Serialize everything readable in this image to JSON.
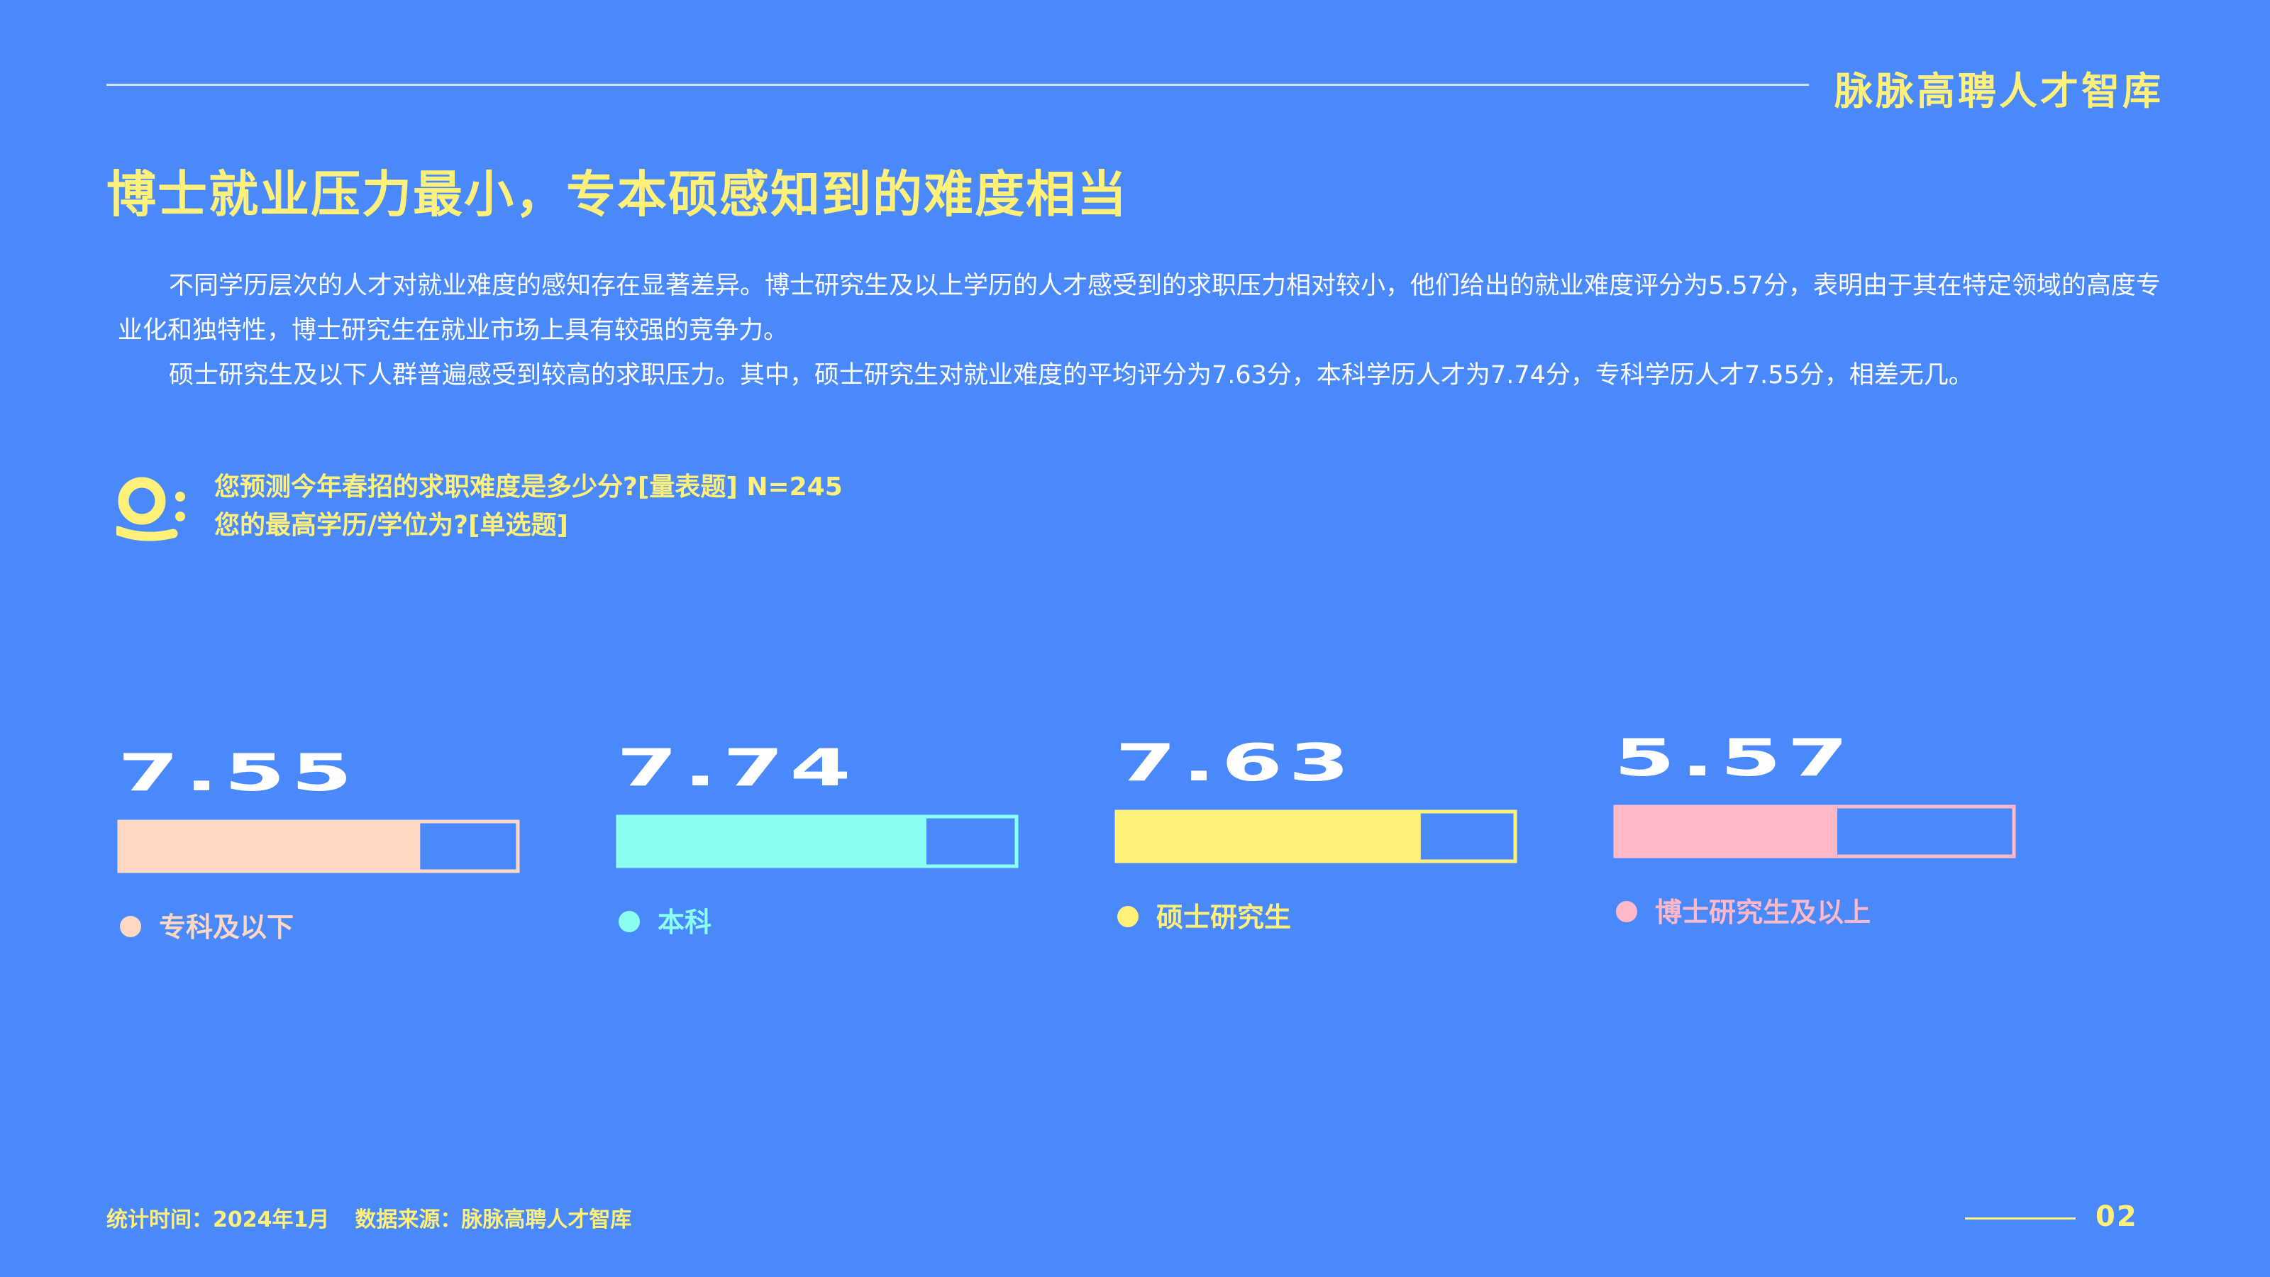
{
  "header": {
    "brand": "脉脉高聘人才智库"
  },
  "title": "博士就业压力最小，专本硕感知到的难度相当",
  "paragraphs": [
    "不同学历层次的人才对就业难度的感知存在显著差异。博士研究生及以上学历的人才感受到的求职压力相对较小，他们给出的就业难度评分为5.57分，表明由于其在特定领域的高度专业化和独特性，博士研究生在就业市场上具有较强的竞争力。",
    "硕士研究生及以下人群普遍感受到较高的求职压力。其中，硕士研究生对就业难度的平均评分为7.63分，本科学历人才为7.74分，专科学历人才7.55分，相差无几。"
  ],
  "questions": [
    "您预测今年春招的求职难度是多少分?[量表题] N=245",
    "您的最高学历/学位为?[单选题]"
  ],
  "chart_data": {
    "type": "bar",
    "categories": [
      "专科及以下",
      "本科",
      "硕士研究生",
      "博士研究生及以上"
    ],
    "values": [
      7.55,
      7.74,
      7.63,
      5.57
    ],
    "value_labels": [
      "7.55",
      "7.74",
      "7.63",
      "5.57"
    ],
    "colors": [
      "#ffd7c2",
      "#8affef",
      "#fff07a",
      "#ffb8c7"
    ],
    "ylim": [
      0,
      10
    ],
    "title": "",
    "xlabel": "",
    "ylabel": ""
  },
  "footer": {
    "date": "统计时间：2024年1月",
    "source": "数据来源：脉脉高聘人才智库",
    "page": "02"
  },
  "colors": {
    "background": "#4a89fc",
    "accent": "#fff07a",
    "text": "#ffffff"
  },
  "icons": {
    "question": "q-icon"
  }
}
